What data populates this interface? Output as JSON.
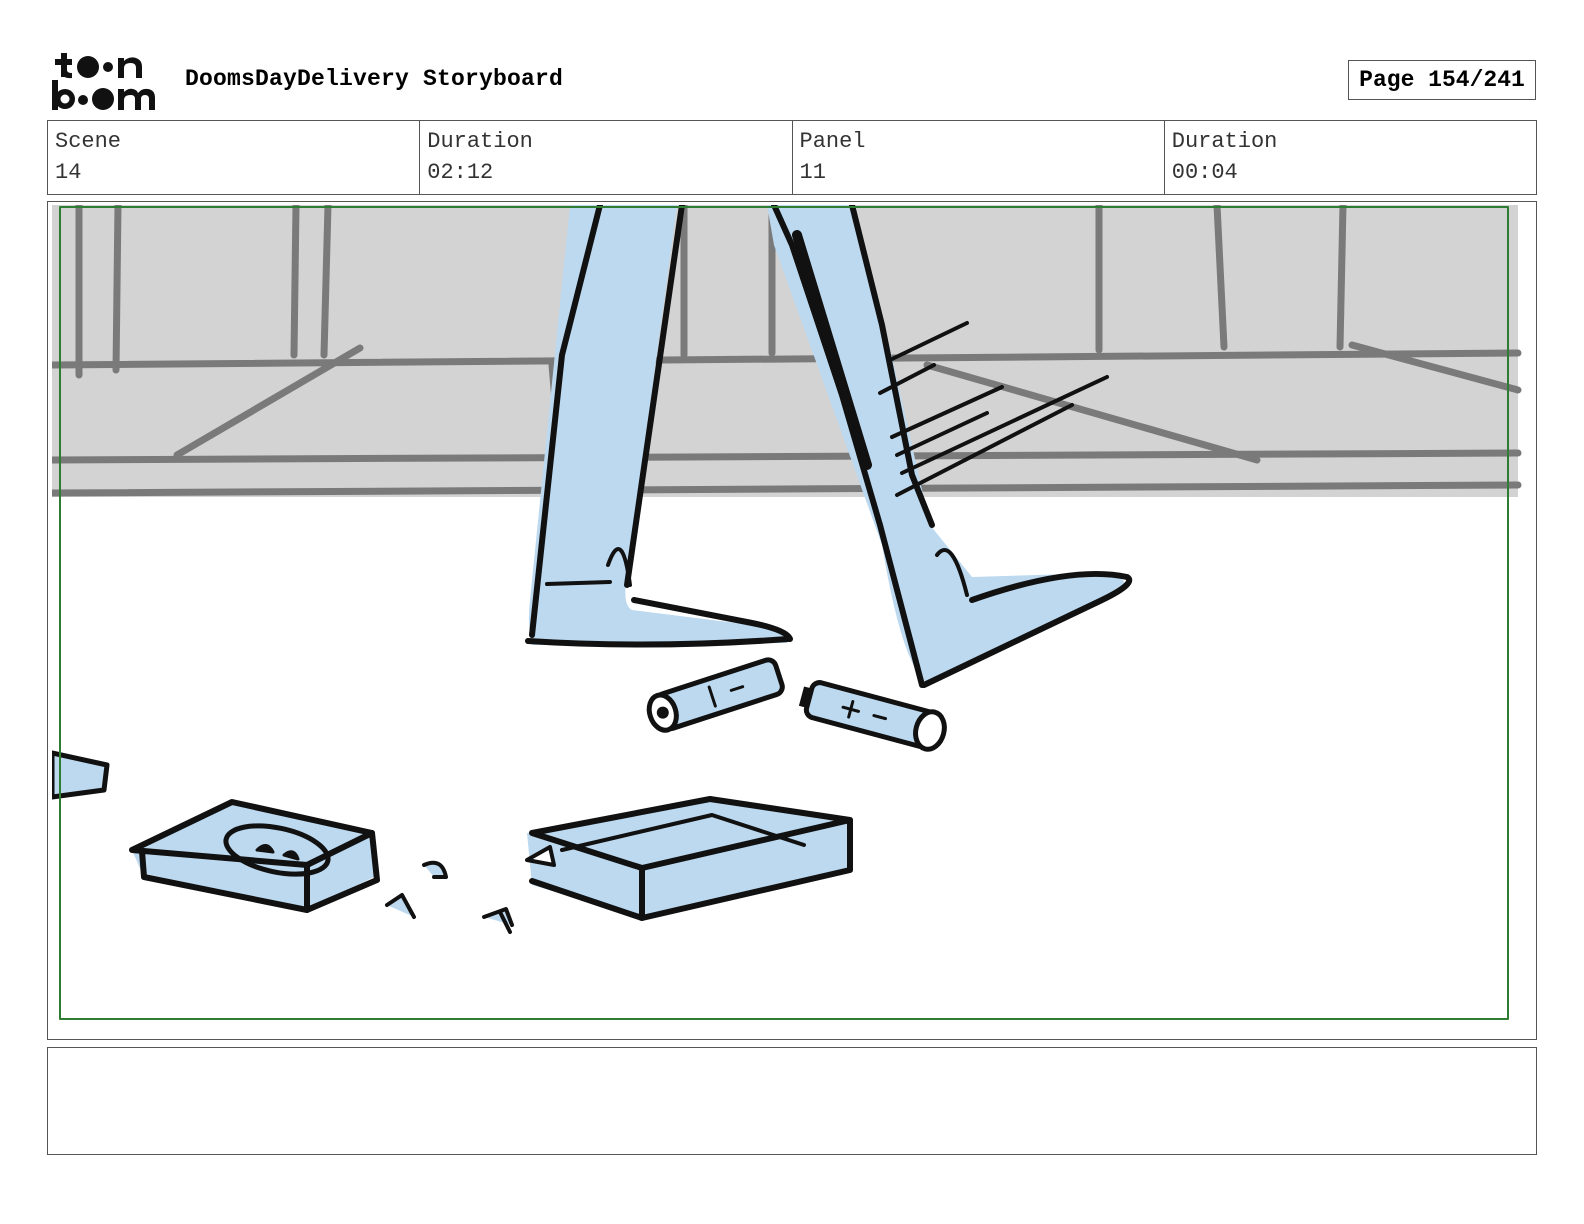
{
  "header": {
    "logo_text": "toonboom",
    "title": "DoomsDayDelivery Storyboard",
    "page": "Page 154/241"
  },
  "info": {
    "scene_label": "Scene",
    "scene_value": "14",
    "scene_duration_label": "Duration",
    "scene_duration_value": "02:12",
    "panel_label": "Panel",
    "panel_value": "11",
    "panel_duration_label": "Duration",
    "panel_duration_value": "00:04"
  },
  "panel_image": {
    "description": "sketch",
    "colors": {
      "fill": "#bcd9f0",
      "background": "#d3d3d3",
      "safe_frame": "#2e7d32",
      "ink": "#111111"
    }
  },
  "notes": {
    "text": ""
  }
}
